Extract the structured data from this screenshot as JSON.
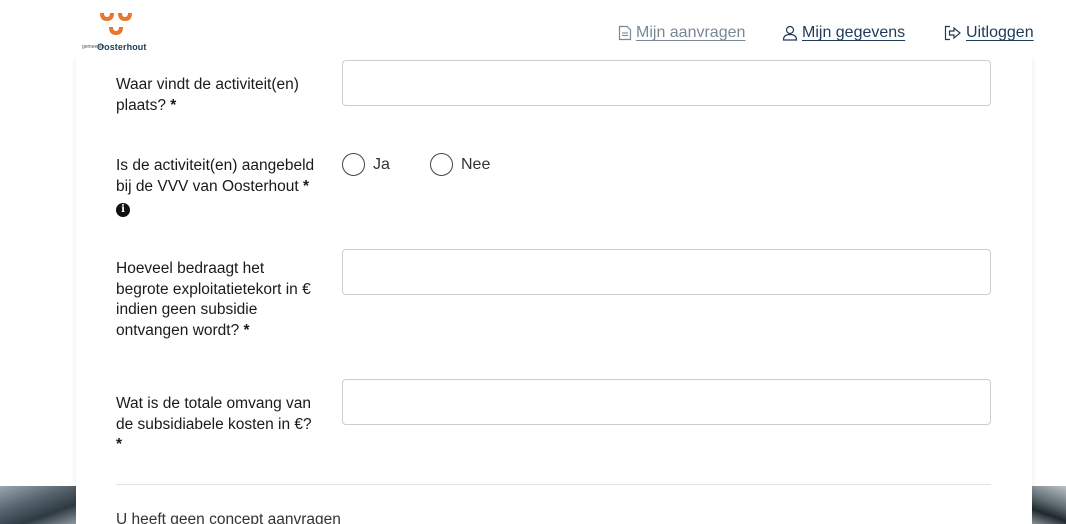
{
  "header": {
    "logo_small": "gemeente",
    "logo_name": "Oosterhout",
    "nav": {
      "aanvragen": "Mijn aanvragen",
      "gegevens": "Mijn gegevens",
      "uitloggen": "Uitloggen"
    }
  },
  "form": {
    "location": {
      "label": "Waar vindt de activiteit(en) plaats?",
      "required": "*",
      "value": ""
    },
    "vvv": {
      "label": "Is de activiteit(en) aangebeld bij de VVV van Oosterhout",
      "required": "*",
      "options": [
        "Ja",
        "Nee"
      ]
    },
    "deficit": {
      "label": "Hoeveel bedraagt het begrote exploitatietekort in € indien geen subsidie ontvangen wordt?",
      "required": "*",
      "value": ""
    },
    "costs": {
      "label": "Wat is de totale omvang van de subsidiabele kosten in €?",
      "required": "*",
      "value": ""
    }
  },
  "concept_message": "U heeft geen concept aanvragen",
  "colors": {
    "brand_orange": "#e8772e",
    "nav_blue": "#1f3b57",
    "muted": "#7a8796"
  }
}
